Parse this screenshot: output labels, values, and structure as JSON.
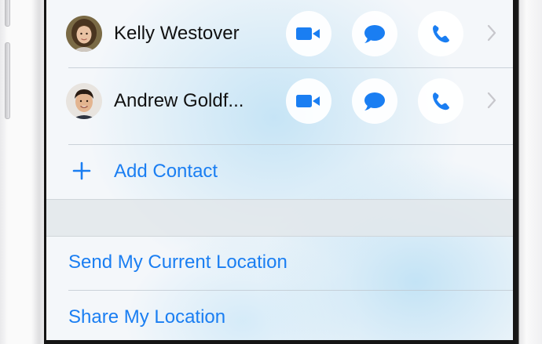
{
  "contacts": [
    {
      "name": "Kelly Westover"
    },
    {
      "name": "Andrew Goldf..."
    }
  ],
  "actions": {
    "video_icon": "video-camera-icon",
    "message_icon": "message-bubble-icon",
    "call_icon": "phone-icon",
    "chevron_icon": "chevron-right-icon"
  },
  "add_contact": {
    "label": "Add Contact",
    "icon": "plus-icon"
  },
  "location": {
    "send_label": "Send My Current Location",
    "share_label": "Share My Location"
  },
  "colors": {
    "accent": "#1a7ef2",
    "text": "#111111",
    "chevron": "#c7c7cc"
  }
}
